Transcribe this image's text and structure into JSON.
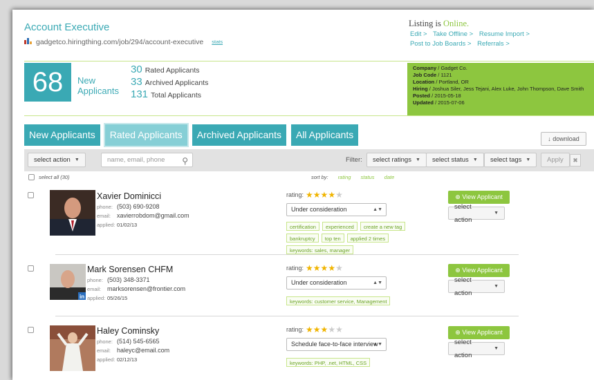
{
  "job": {
    "title": "Account Executive",
    "url": "gadgetco.hiringthing.com/job/294/account-executive",
    "stats_link": "stats"
  },
  "listing": {
    "prefix": "Listing is",
    "status": "Online.",
    "links_row1": [
      "Edit >",
      "Take Offline >",
      "Resume Import >"
    ],
    "links_row2": [
      "Post to Job Boards >",
      "Referrals >"
    ]
  },
  "summary": {
    "new_count": "68",
    "new_label_1": "New",
    "new_label_2": "Applicants",
    "rated_count": "30",
    "rated_label": "Rated Applicants",
    "archived_count": "33",
    "archived_label": "Archived Applicants",
    "total_count": "131",
    "total_label": "Total Applicants"
  },
  "company": {
    "company_key": "Company",
    "company_val": "Gadget Co.",
    "jobcode_key": "Job Code",
    "jobcode_val": "1121",
    "location_key": "Location",
    "location_val": "Portland, OR",
    "hiring_key": "Hiring",
    "hiring_val": "Joshua Siler, Jess Tejani, Alex Luke, John Thompson, Dave Smith",
    "posted_key": "Posted",
    "posted_val": "2015-05-18",
    "updated_key": "Updated",
    "updated_val": "2015-07-06"
  },
  "tabs": [
    "New Applicants",
    "Rated Applicants",
    "Archived Applicants",
    "All Applicants"
  ],
  "active_tab": 1,
  "toolbar": {
    "download": "download",
    "select_action": "select action",
    "search_placeholder": "name, email, phone",
    "filter_label": "Filter:",
    "select_ratings": "select ratings",
    "select_status": "select status",
    "select_tags": "select tags",
    "apply": "Apply",
    "clear": "✖",
    "select_all": "select all (30)",
    "sort_by": "sort by:",
    "sort_rating": "rating",
    "sort_status": "status",
    "sort_date": "date"
  },
  "labels": {
    "phone": "phone:",
    "email": "email:",
    "applied": "applied:",
    "rating": "rating:",
    "view_applicant": "View Applicant",
    "select_action": "select action"
  },
  "applicants": [
    {
      "name": "Xavier Dominicci",
      "phone": "(503) 690-9208",
      "email": "xavierrobdom@gmail.com",
      "applied": "01/02/13",
      "rating": 4,
      "status": "Under consideration",
      "tags": [
        "certification",
        "experienced",
        "create a new tag",
        "bankruptcy",
        "top ten",
        "applied 2 times",
        "keywords: sales, manager"
      ]
    },
    {
      "name": "Mark Sorensen CHFM",
      "phone": "(503) 348-3371",
      "email": "marksorensen@frontier.com",
      "applied": "05/26/15",
      "rating": 4,
      "status": "Under consideration",
      "tags": [
        "keywords: customer service, Management"
      ]
    },
    {
      "name": "Haley Cominsky",
      "phone": "(514) 545-6565",
      "email": "haleyc@email.com",
      "applied": "02/12/13",
      "rating": 3,
      "status": "Schedule face-to-face interview",
      "tags": [
        "keywords: PHP, .net, HTML, CSS"
      ]
    }
  ],
  "colors": {
    "teal": "#3aa9b4",
    "green": "#8dc63f"
  }
}
